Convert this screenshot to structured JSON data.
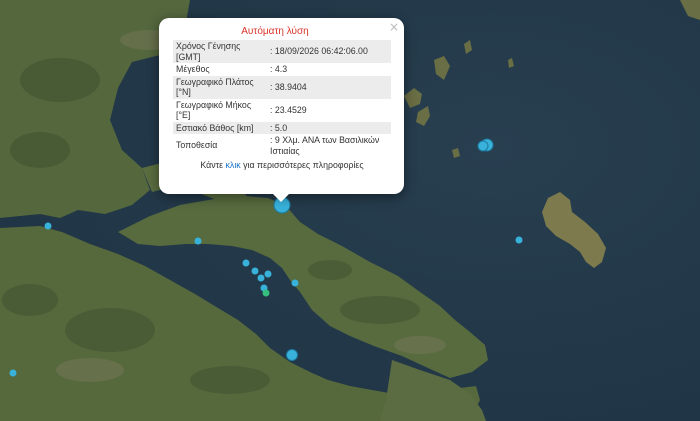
{
  "popup": {
    "title": "Αυτόματη λύση",
    "close_symbol": "×",
    "rows": [
      {
        "label": "Χρόνος Γένησης [GMT]",
        "value": ": 18/09/2026 06:42:06.00"
      },
      {
        "label": "Μέγεθος",
        "value": ": 4.3"
      },
      {
        "label": "Γεωγραφικό Πλάτος [°N]",
        "value": ": 38.9404"
      },
      {
        "label": "Γεωγραφικό Μήκος [°E]",
        "value": ": 23.4529"
      },
      {
        "label": "Εστιακό Βάθος [km]",
        "value": ": 5.0"
      },
      {
        "label": "Τοποθεσία",
        "value": ": 9 Χλμ. ΑΝΑ των Βασιλικών Ιστιαίας"
      }
    ],
    "more_prefix": "Κάντε",
    "more_link": "κλικ",
    "more_suffix": "για περισσότερες πληροφορίες"
  },
  "map": {
    "sea_color": "#243a4a",
    "land_color": "#55683c",
    "event_color": "#38b2da",
    "recent_event_color": "#36c07e"
  }
}
